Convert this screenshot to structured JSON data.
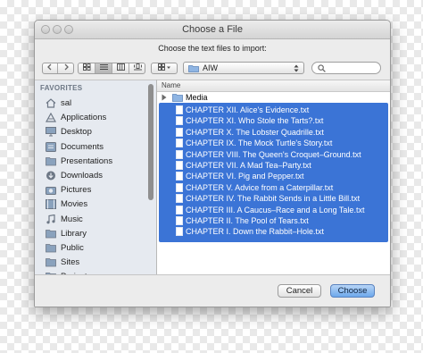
{
  "dialog": {
    "title": "Choose a File",
    "prompt": "Choose the text files to import:"
  },
  "toolbar": {
    "back_icon": "chevron-left-icon",
    "forward_icon": "chevron-right-icon",
    "view_modes": [
      "icon-view",
      "list-view",
      "column-view",
      "cover-flow-view"
    ],
    "selected_view": "list-view",
    "arrange_icon": "grid-icon",
    "location": "AIW",
    "search_placeholder": ""
  },
  "sidebar": {
    "heading": "FAVORITES",
    "items": [
      {
        "label": "sal",
        "icon": "home-icon"
      },
      {
        "label": "Applications",
        "icon": "applications-icon"
      },
      {
        "label": "Desktop",
        "icon": "desktop-icon"
      },
      {
        "label": "Documents",
        "icon": "documents-icon"
      },
      {
        "label": "Presentations",
        "icon": "folder-icon"
      },
      {
        "label": "Downloads",
        "icon": "downloads-icon"
      },
      {
        "label": "Pictures",
        "icon": "camera-icon"
      },
      {
        "label": "Movies",
        "icon": "film-icon"
      },
      {
        "label": "Music",
        "icon": "music-icon"
      },
      {
        "label": "Library",
        "icon": "folder-icon"
      },
      {
        "label": "Public",
        "icon": "folder-icon"
      },
      {
        "label": "Sites",
        "icon": "folder-icon"
      },
      {
        "label": "Projects",
        "icon": "folder-icon"
      }
    ]
  },
  "file_list": {
    "column_header": "Name",
    "folder": "Media",
    "files": [
      "CHAPTER XII. Alice's Evidence.txt",
      "CHAPTER XI. Who Stole the Tarts?.txt",
      "CHAPTER X. The Lobster Quadrille.txt",
      "CHAPTER IX. The Mock Turtle's Story.txt",
      "CHAPTER VIII. The Queen's Croquet–Ground.txt",
      "CHAPTER VII. A Mad Tea–Party.txt",
      "CHAPTER VI. Pig and Pepper.txt",
      "CHAPTER V. Advice from a Caterpillar.txt",
      "CHAPTER IV. The Rabbit Sends in a Little Bill.txt",
      "CHAPTER III. A Caucus–Race and a Long Tale.txt",
      "CHAPTER II. The Pool of Tears.txt",
      "CHAPTER I. Down the Rabbit–Hole.txt"
    ]
  },
  "buttons": {
    "cancel": "Cancel",
    "choose": "Choose"
  },
  "colors": {
    "selection": "#3b74d6",
    "default_button": "#6da8ec"
  }
}
